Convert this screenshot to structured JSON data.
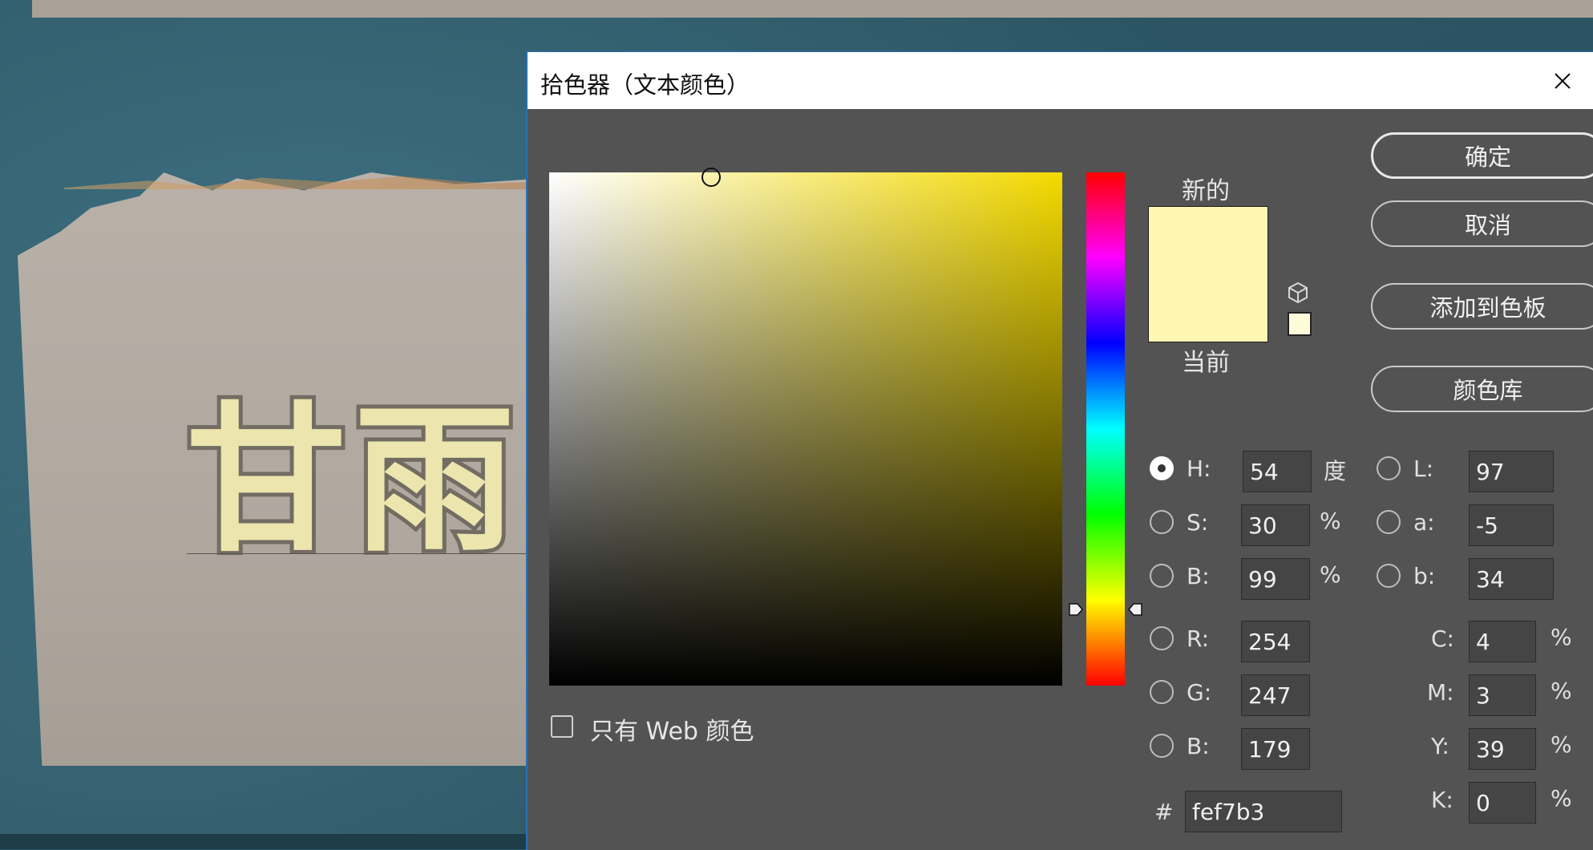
{
  "canvas": {
    "text": "甘雨"
  },
  "dialog": {
    "title": "拾色器（文本颜色）",
    "labels": {
      "new": "新的",
      "current": "当前"
    },
    "buttons": {
      "ok": "确定",
      "cancel": "取消",
      "add_to_swatches": "添加到色板",
      "color_libraries": "颜色库"
    },
    "checkbox": {
      "label": "只有 Web 颜色",
      "checked": false
    },
    "new_color": "#fef7b3",
    "hue_value": 54,
    "fields": {
      "H": {
        "label": "H:",
        "value": "54",
        "unit": "度",
        "selected": true
      },
      "S": {
        "label": "S:",
        "value": "30",
        "unit": "%"
      },
      "B_hsb": {
        "label": "B:",
        "value": "99",
        "unit": "%"
      },
      "R": {
        "label": "R:",
        "value": "254"
      },
      "G": {
        "label": "G:",
        "value": "247"
      },
      "B_rgb": {
        "label": "B:",
        "value": "179"
      },
      "L": {
        "label": "L:",
        "value": "97"
      },
      "a": {
        "label": "a:",
        "value": "-5"
      },
      "b": {
        "label": "b:",
        "value": "34"
      },
      "C": {
        "label": "C:",
        "value": "4",
        "unit": "%"
      },
      "M": {
        "label": "M:",
        "value": "3",
        "unit": "%"
      },
      "Y": {
        "label": "Y:",
        "value": "39",
        "unit": "%"
      },
      "K": {
        "label": "K:",
        "value": "0",
        "unit": "%"
      },
      "hex": {
        "label": "#",
        "value": "fef7b3"
      }
    }
  }
}
